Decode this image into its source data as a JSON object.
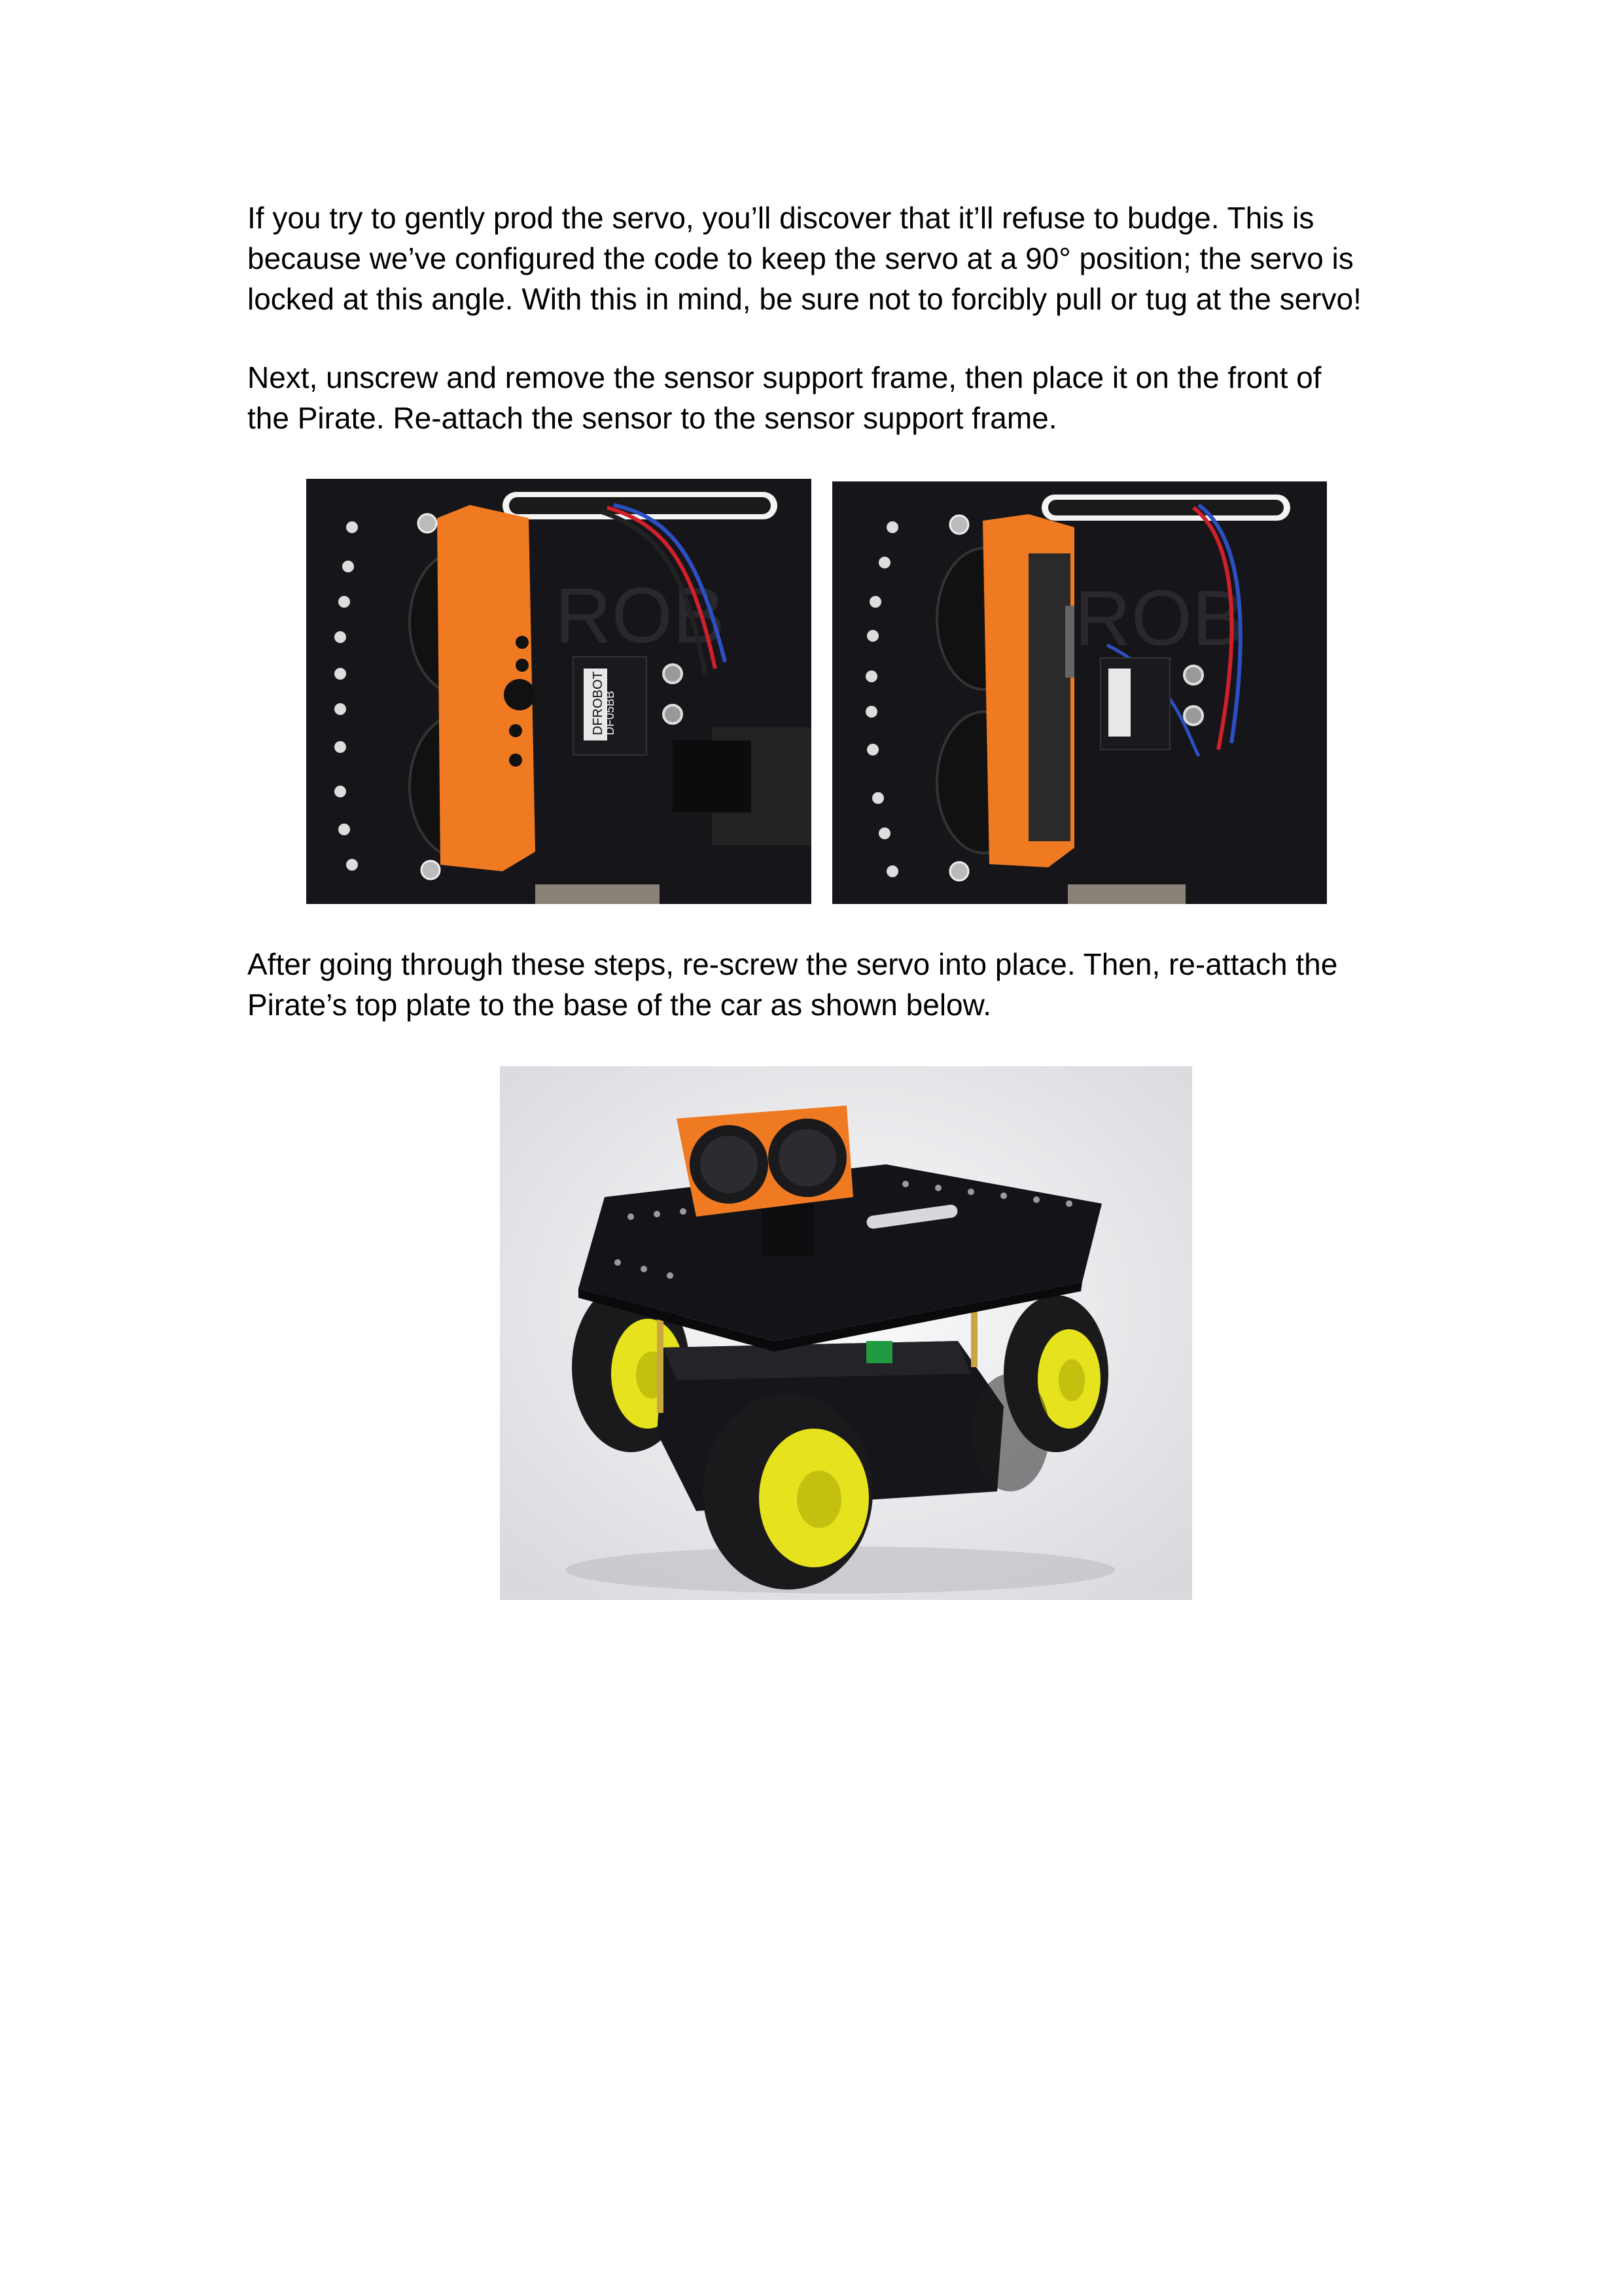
{
  "paragraphs": [
    {
      "lines": [
        "If you try to gently prod the servo, you’ll discover that it’ll refuse to budge. This is",
        "because we’ve configured the code to keep the servo at a 90° position; the servo is",
        "locked at this angle. With this in mind, be sure not to forcibly pull or tug at the servo!"
      ]
    },
    {
      "lines": [
        "Next, unscrew and remove the sensor support frame, then place it on the front of",
        "the Pirate. Re-attach the sensor to the sensor support frame."
      ]
    },
    {
      "lines": [
        "After going through these steps, re-screw the servo into place. Then, re-attach the",
        "Pirate’s top plate to the base of the car as shown below."
      ]
    }
  ],
  "photos": {
    "left": {
      "servo_label_brand": "DFROBOT",
      "servo_label_model": "DF05BB"
    },
    "right": {},
    "car": {}
  },
  "colors": {
    "plate": "#141418",
    "bracket": "#f07a22",
    "wheel_hub": "#e6e21e",
    "tire": "#1a1a1c",
    "wire_red": "#d0202a",
    "wire_blue": "#2c4fc4"
  }
}
